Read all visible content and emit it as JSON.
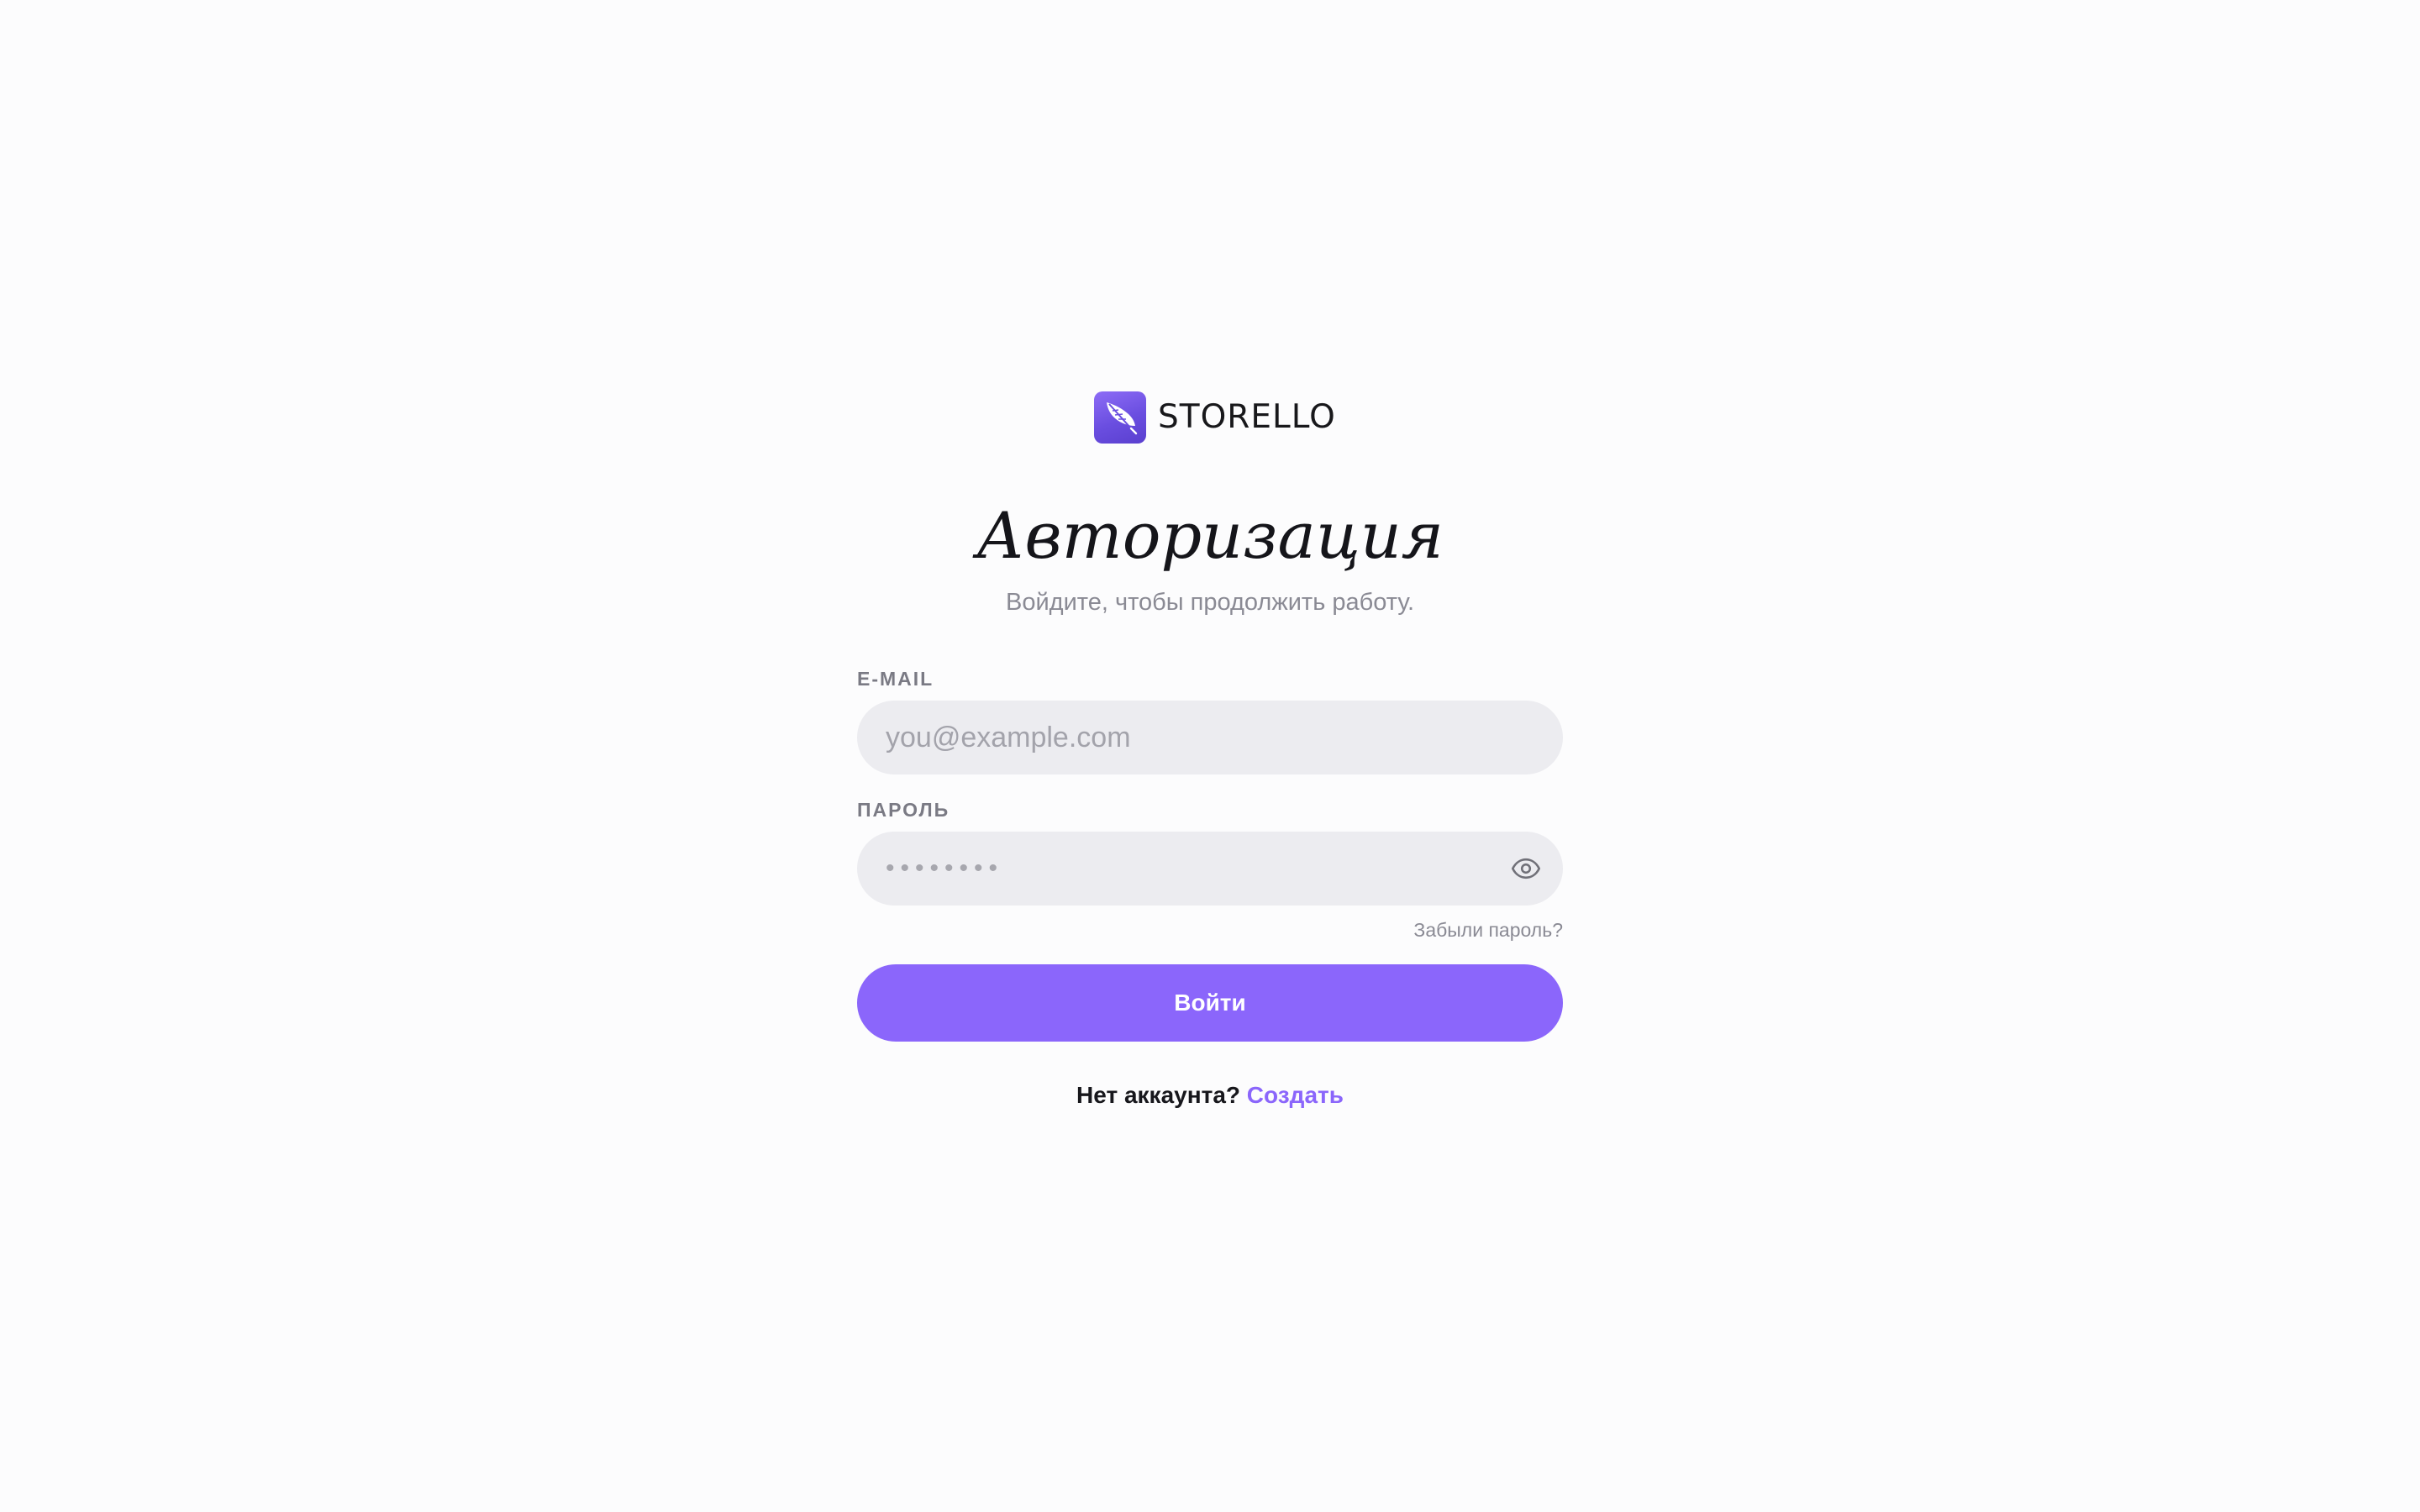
{
  "brand": {
    "name": "STORELLO",
    "logo_icon": "feather-icon",
    "logo_color": "#7758e8"
  },
  "auth": {
    "title": "Авторизация",
    "subtitle": "Войдите, чтобы продолжить работу.",
    "email": {
      "label": "E-MAIL",
      "placeholder": "you@example.com",
      "value": ""
    },
    "password": {
      "label": "ПАРОЛЬ",
      "placeholder": "••••••••",
      "value": "",
      "toggle_icon": "eye-icon"
    },
    "forgot_label": "Забыли пароль?",
    "submit_label": "Войти",
    "signup_prompt": "Нет аккаунта?",
    "signup_link": "Создать"
  },
  "colors": {
    "accent": "#8b66fb",
    "background": "#fcfcfd",
    "input_bg": "#ececf0",
    "muted_text": "#8a8a94"
  }
}
